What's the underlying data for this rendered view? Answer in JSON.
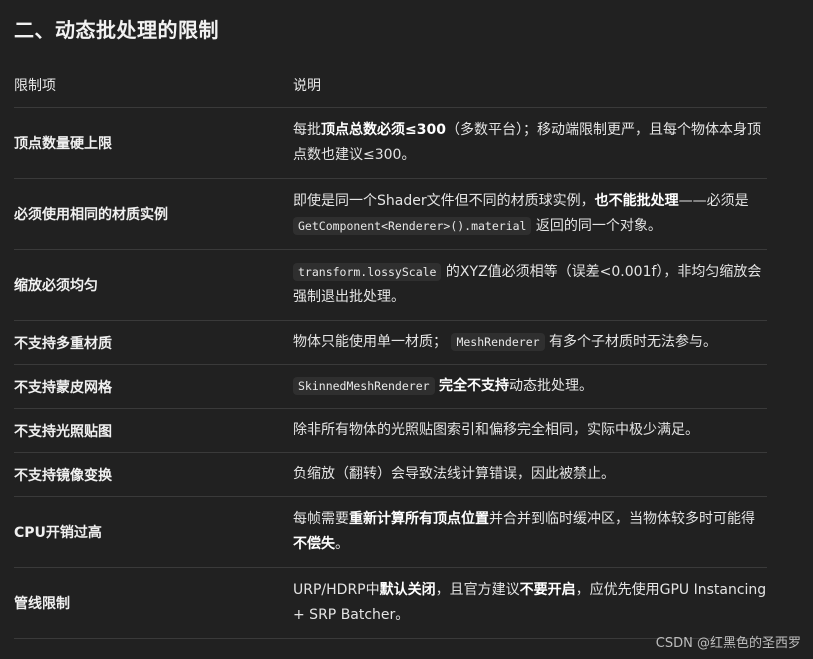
{
  "title": "二、动态批处理的限制",
  "table": {
    "headers": [
      "限制项",
      "说明"
    ],
    "rows": [
      {
        "item": "顶点数量硬上限",
        "desc": [
          {
            "t": "text",
            "v": "每批"
          },
          {
            "t": "bold",
            "v": "顶点总数必须≤300"
          },
          {
            "t": "text",
            "v": "（多数平台）；移动端限制更严，且每个物体本身顶点数也建议≤300。"
          }
        ]
      },
      {
        "item": "必须使用相同的材质实例",
        "desc": [
          {
            "t": "text",
            "v": "即使是同一个Shader文件但不同的材质球实例，"
          },
          {
            "t": "bold",
            "v": "也不能批处理"
          },
          {
            "t": "text",
            "v": "——必须是 "
          },
          {
            "t": "code",
            "v": "GetComponent<Renderer>().material"
          },
          {
            "t": "text",
            "v": " 返回的同一个对象。"
          }
        ]
      },
      {
        "item": "缩放必须均匀",
        "desc": [
          {
            "t": "code",
            "v": "transform.lossyScale"
          },
          {
            "t": "text",
            "v": " 的XYZ值必须相等（误差<0.001f），非均匀缩放会强制退出批处理。"
          }
        ]
      },
      {
        "item": "不支持多重材质",
        "desc": [
          {
            "t": "text",
            "v": "物体只能使用单一材质； "
          },
          {
            "t": "code",
            "v": "MeshRenderer"
          },
          {
            "t": "text",
            "v": " 有多个子材质时无法参与。"
          }
        ]
      },
      {
        "item": "不支持蒙皮网格",
        "desc": [
          {
            "t": "code",
            "v": "SkinnedMeshRenderer"
          },
          {
            "t": "text",
            "v": " "
          },
          {
            "t": "bold",
            "v": "完全不支持"
          },
          {
            "t": "text",
            "v": "动态批处理。"
          }
        ]
      },
      {
        "item": "不支持光照贴图",
        "desc": [
          {
            "t": "text",
            "v": "除非所有物体的光照贴图索引和偏移完全相同，实际中极少满足。"
          }
        ]
      },
      {
        "item": "不支持镜像变换",
        "desc": [
          {
            "t": "text",
            "v": "负缩放（翻转）会导致法线计算错误，因此被禁止。"
          }
        ]
      },
      {
        "item": "CPU开销过高",
        "desc": [
          {
            "t": "text",
            "v": "每帧需要"
          },
          {
            "t": "bold",
            "v": "重新计算所有顶点位置"
          },
          {
            "t": "text",
            "v": "并合并到临时缓冲区，当物体较多时可能得"
          },
          {
            "t": "bold",
            "v": "不偿失"
          },
          {
            "t": "text",
            "v": "。"
          }
        ]
      },
      {
        "item": "管线限制",
        "desc": [
          {
            "t": "text",
            "v": "URP/HDRP中"
          },
          {
            "t": "bold",
            "v": "默认关闭"
          },
          {
            "t": "text",
            "v": "，且官方建议"
          },
          {
            "t": "bold",
            "v": "不要开启"
          },
          {
            "t": "text",
            "v": "，应优先使用GPU Instancing + SRP Batcher。"
          }
        ]
      }
    ]
  },
  "watermark": "CSDN @红黑色的圣西罗"
}
